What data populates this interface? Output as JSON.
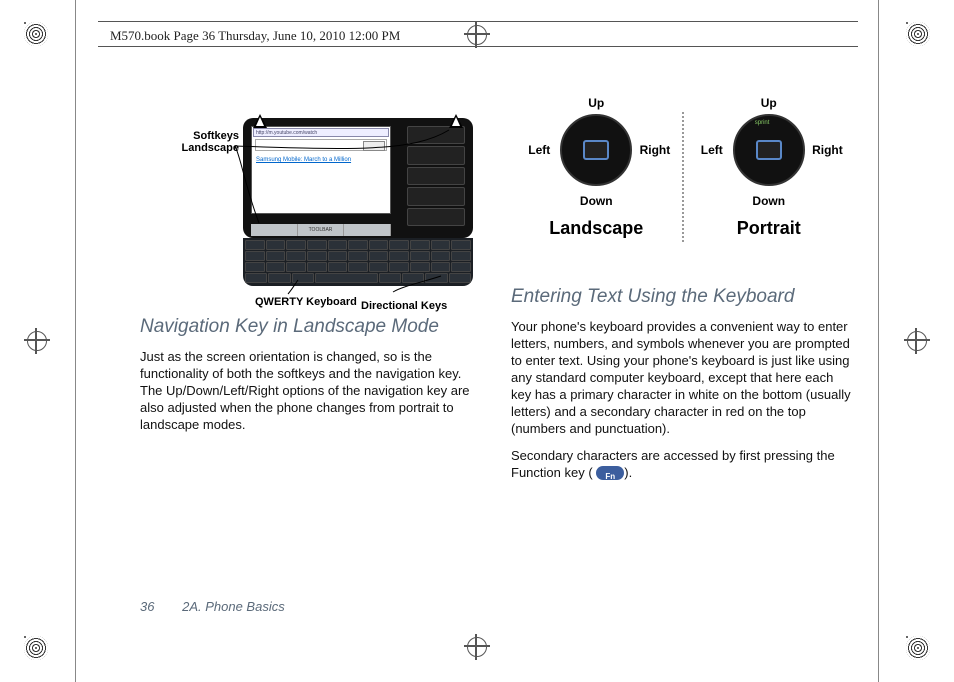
{
  "meta": {
    "header": "M570.book  Page 36  Thursday, June 10, 2010  12:00 PM"
  },
  "leftcol": {
    "callouts": {
      "softkeys": "Softkeys Landscape",
      "qwerty": "QWERTY Keyboard",
      "dirkeys": "Directional Keys"
    },
    "screen": {
      "url": "http://m.youtube.com/watch",
      "link": "Samsung Mobile: March to a Million",
      "softkey_left": "",
      "softkey_mid": "TOOLBAR",
      "softkey_right": ""
    },
    "heading": "Navigation Key in Landscape Mode",
    "para": "Just as the screen orientation is changed, so is the functionality of both the softkeys and the navigation key. The Up/Down/Left/Right options of the navigation key are also adjusted when the phone changes from portrait to landscape modes."
  },
  "rightcol": {
    "labels": {
      "up": "Up",
      "down": "Down",
      "left": "Left",
      "right": "Right"
    },
    "modes": {
      "landscape": "Landscape",
      "portrait": "Portrait"
    },
    "heading": "Entering Text Using the Keyboard",
    "para1": "Your phone's keyboard provides a convenient way to enter letters, numbers, and symbols whenever you are prompted to enter text. Using your phone's keyboard is just like using any standard computer keyboard, except that here each key has a primary character in white on the bottom (usually letters) and a secondary character in red on the top (numbers and punctuation).",
    "para2a": "Secondary characters are accessed by first pressing the Function key (",
    "para2b": ")."
  },
  "footer": {
    "page": "36",
    "section": "2A. Phone Basics"
  }
}
